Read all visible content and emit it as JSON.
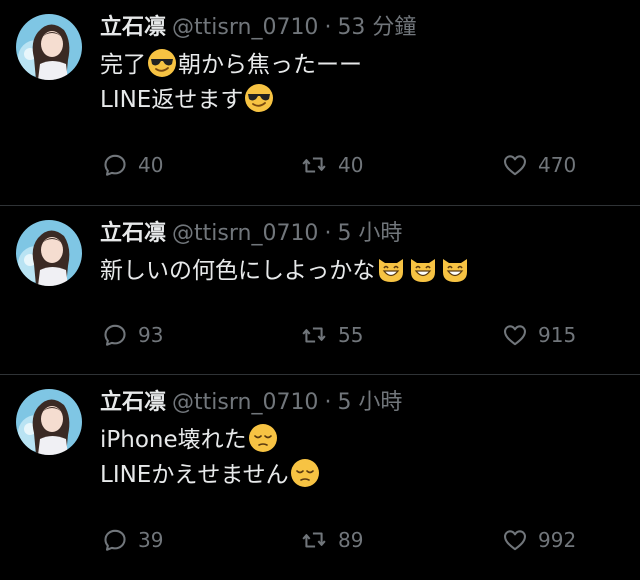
{
  "colors": {
    "background": "#000000",
    "text": "#e7e9ea",
    "muted": "#71767b",
    "divider": "#2f3336"
  },
  "tweets": [
    {
      "name": "立石凛",
      "handle": "@ttisrn_0710",
      "separator": "·",
      "time": "53 分鐘",
      "line1": [
        "完了",
        "sunglasses-emoji",
        "朝から焦ったーー"
      ],
      "line1_text_a": "完了",
      "line1_emoji": "sunglasses-emoji",
      "line1_text_b": "朝から焦ったーー",
      "line2_text": "LINE返せます",
      "line2_emoji": "sunglasses-emoji",
      "replies": "40",
      "retweets": "40",
      "likes": "470"
    },
    {
      "name": "立石凛",
      "handle": "@ttisrn_0710",
      "separator": "·",
      "time": "5 小時",
      "line1_text": "新しいの何色にしよっかな",
      "line1_emoji": "grinning-cat-emoji",
      "replies": "93",
      "retweets": "55",
      "likes": "915"
    },
    {
      "name": "立石凛",
      "handle": "@ttisrn_0710",
      "separator": "·",
      "time": "5 小時",
      "line1_text": "iPhone壊れた",
      "line1_emoji": "pensive-emoji",
      "line2_text": "LINEかえせません",
      "line2_emoji": "pensive-emoji",
      "replies": "39",
      "retweets": "89",
      "likes": "992"
    }
  ],
  "icons": {
    "reply": "reply-icon",
    "retweet": "retweet-icon",
    "like": "heart-icon"
  }
}
